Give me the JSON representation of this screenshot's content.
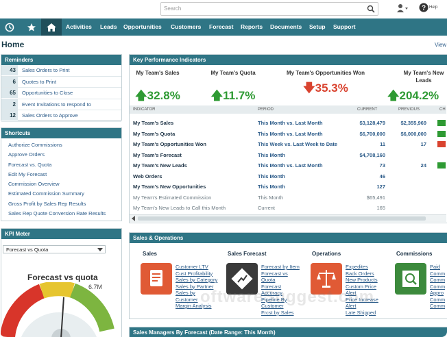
{
  "search": {
    "placeholder": "Search"
  },
  "header": {
    "help_label": "Help",
    "page_title": "Home",
    "view_link": "View"
  },
  "nav": {
    "items": [
      "Activities",
      "Leads",
      "Opportunities",
      "Customers",
      "Forecast",
      "Reports",
      "Documents",
      "Setup",
      "Support"
    ]
  },
  "reminders": {
    "title": "Reminders",
    "items": [
      {
        "count": "43",
        "label": "Sales Orders to Print"
      },
      {
        "count": "6",
        "label": "Quotes to Print"
      },
      {
        "count": "65",
        "label": "Opportunities to Close"
      },
      {
        "count": "2",
        "label": "Event Invitations to respond to"
      },
      {
        "count": "12",
        "label": "Sales Orders to Approve"
      }
    ]
  },
  "shortcuts": {
    "title": "Shortcuts",
    "items": [
      "Authorize Commissions",
      "Approve Orders",
      "Forecast vs. Quota",
      "Edit My Forecast",
      "Commission Overview",
      "Estimated Commission Summary",
      "Gross Profit by Sales Rep Results",
      "Sales Rep Quote Conversion Rate Results"
    ]
  },
  "kpi_meter": {
    "title": "KPI Meter",
    "selected": "Forecast vs Quota",
    "gauge_title": "Forecast vs quota",
    "gauge_max": "6.7M"
  },
  "kpi": {
    "title": "Key Performance Indicators",
    "cards": [
      {
        "label": "My Team's Sales",
        "value": "32.8%",
        "direction": "up"
      },
      {
        "label": "My Team's Quota",
        "value": "11.7%",
        "direction": "up"
      },
      {
        "label": "My Team's Opportunities Won",
        "value": "35.3%",
        "direction": "down"
      },
      {
        "label": "My Team's New Leads",
        "value": "204.2%",
        "direction": "up"
      }
    ],
    "columns": [
      "INDICATOR",
      "PERIOD",
      "CURRENT",
      "PREVIOUS",
      "CH"
    ],
    "rows": [
      {
        "indicator": "My Team's Sales",
        "period": "This Month vs. Last Month",
        "current": "$3,128,479",
        "previous": "$2,355,969",
        "trend": "up"
      },
      {
        "indicator": "My Team's Quota",
        "period": "This Month vs. Last Month",
        "current": "$6,700,000",
        "previous": "$6,000,000",
        "trend": "up"
      },
      {
        "indicator": "My Team's Opportunities Won",
        "period": "This Week vs. Last Week to Date",
        "current": "11",
        "previous": "17",
        "trend": "down"
      },
      {
        "indicator": "My Team's Forecast",
        "period": "This Month",
        "current": "$4,708,160",
        "previous": "",
        "trend": ""
      },
      {
        "indicator": "My Team's New Leads",
        "period": "This Month vs. Last Month",
        "current": "73",
        "previous": "24",
        "trend": "up"
      },
      {
        "indicator": "Web Orders",
        "period": "This Month",
        "current": "46",
        "previous": "",
        "trend": ""
      },
      {
        "indicator": "My Team's New Opportunities",
        "period": "This Month",
        "current": "127",
        "previous": "",
        "trend": ""
      },
      {
        "indicator": "My Team's Estimated Commission",
        "period": "This Month",
        "current": "$65,491",
        "previous": "",
        "trend": ""
      },
      {
        "indicator": "My Team's New Leads to Call this Month",
        "period": "Current",
        "current": "165",
        "previous": "",
        "trend": ""
      }
    ]
  },
  "sales_ops": {
    "title": "Sales & Operations",
    "columns": [
      {
        "title": "Sales",
        "links": [
          "Customer LTV",
          "Cust Profitability",
          "Sales by Category",
          "Sales by Partner",
          "Sales by",
          "Customer",
          "Margin Analysis"
        ]
      },
      {
        "title": "Sales Forecast",
        "links": [
          "Forecast by Item",
          "Forecast vs",
          "Quota",
          "Forecast",
          "Accuracy",
          "Pipeline By",
          "Customer",
          "Frcst by Sales"
        ]
      },
      {
        "title": "Operations",
        "links": [
          "Expedites",
          "Back Orders",
          "New Products",
          "Custom Price",
          "Alert",
          "Price Increase",
          "Alert",
          "Late Shipped"
        ]
      },
      {
        "title": "Commissions",
        "links": [
          "Paid",
          "Comm",
          "Comm",
          "Comm",
          "Appro",
          "Comm",
          "Comm"
        ]
      }
    ]
  },
  "bottom_panel": {
    "title": "Sales Managers By Forecast (Date Range: This Month)"
  },
  "watermark": "oftwareSuggest.com",
  "colors": {
    "nav": "#2f7585",
    "up": "#2e9a33",
    "down": "#d9432f",
    "link": "#2a5a88"
  }
}
